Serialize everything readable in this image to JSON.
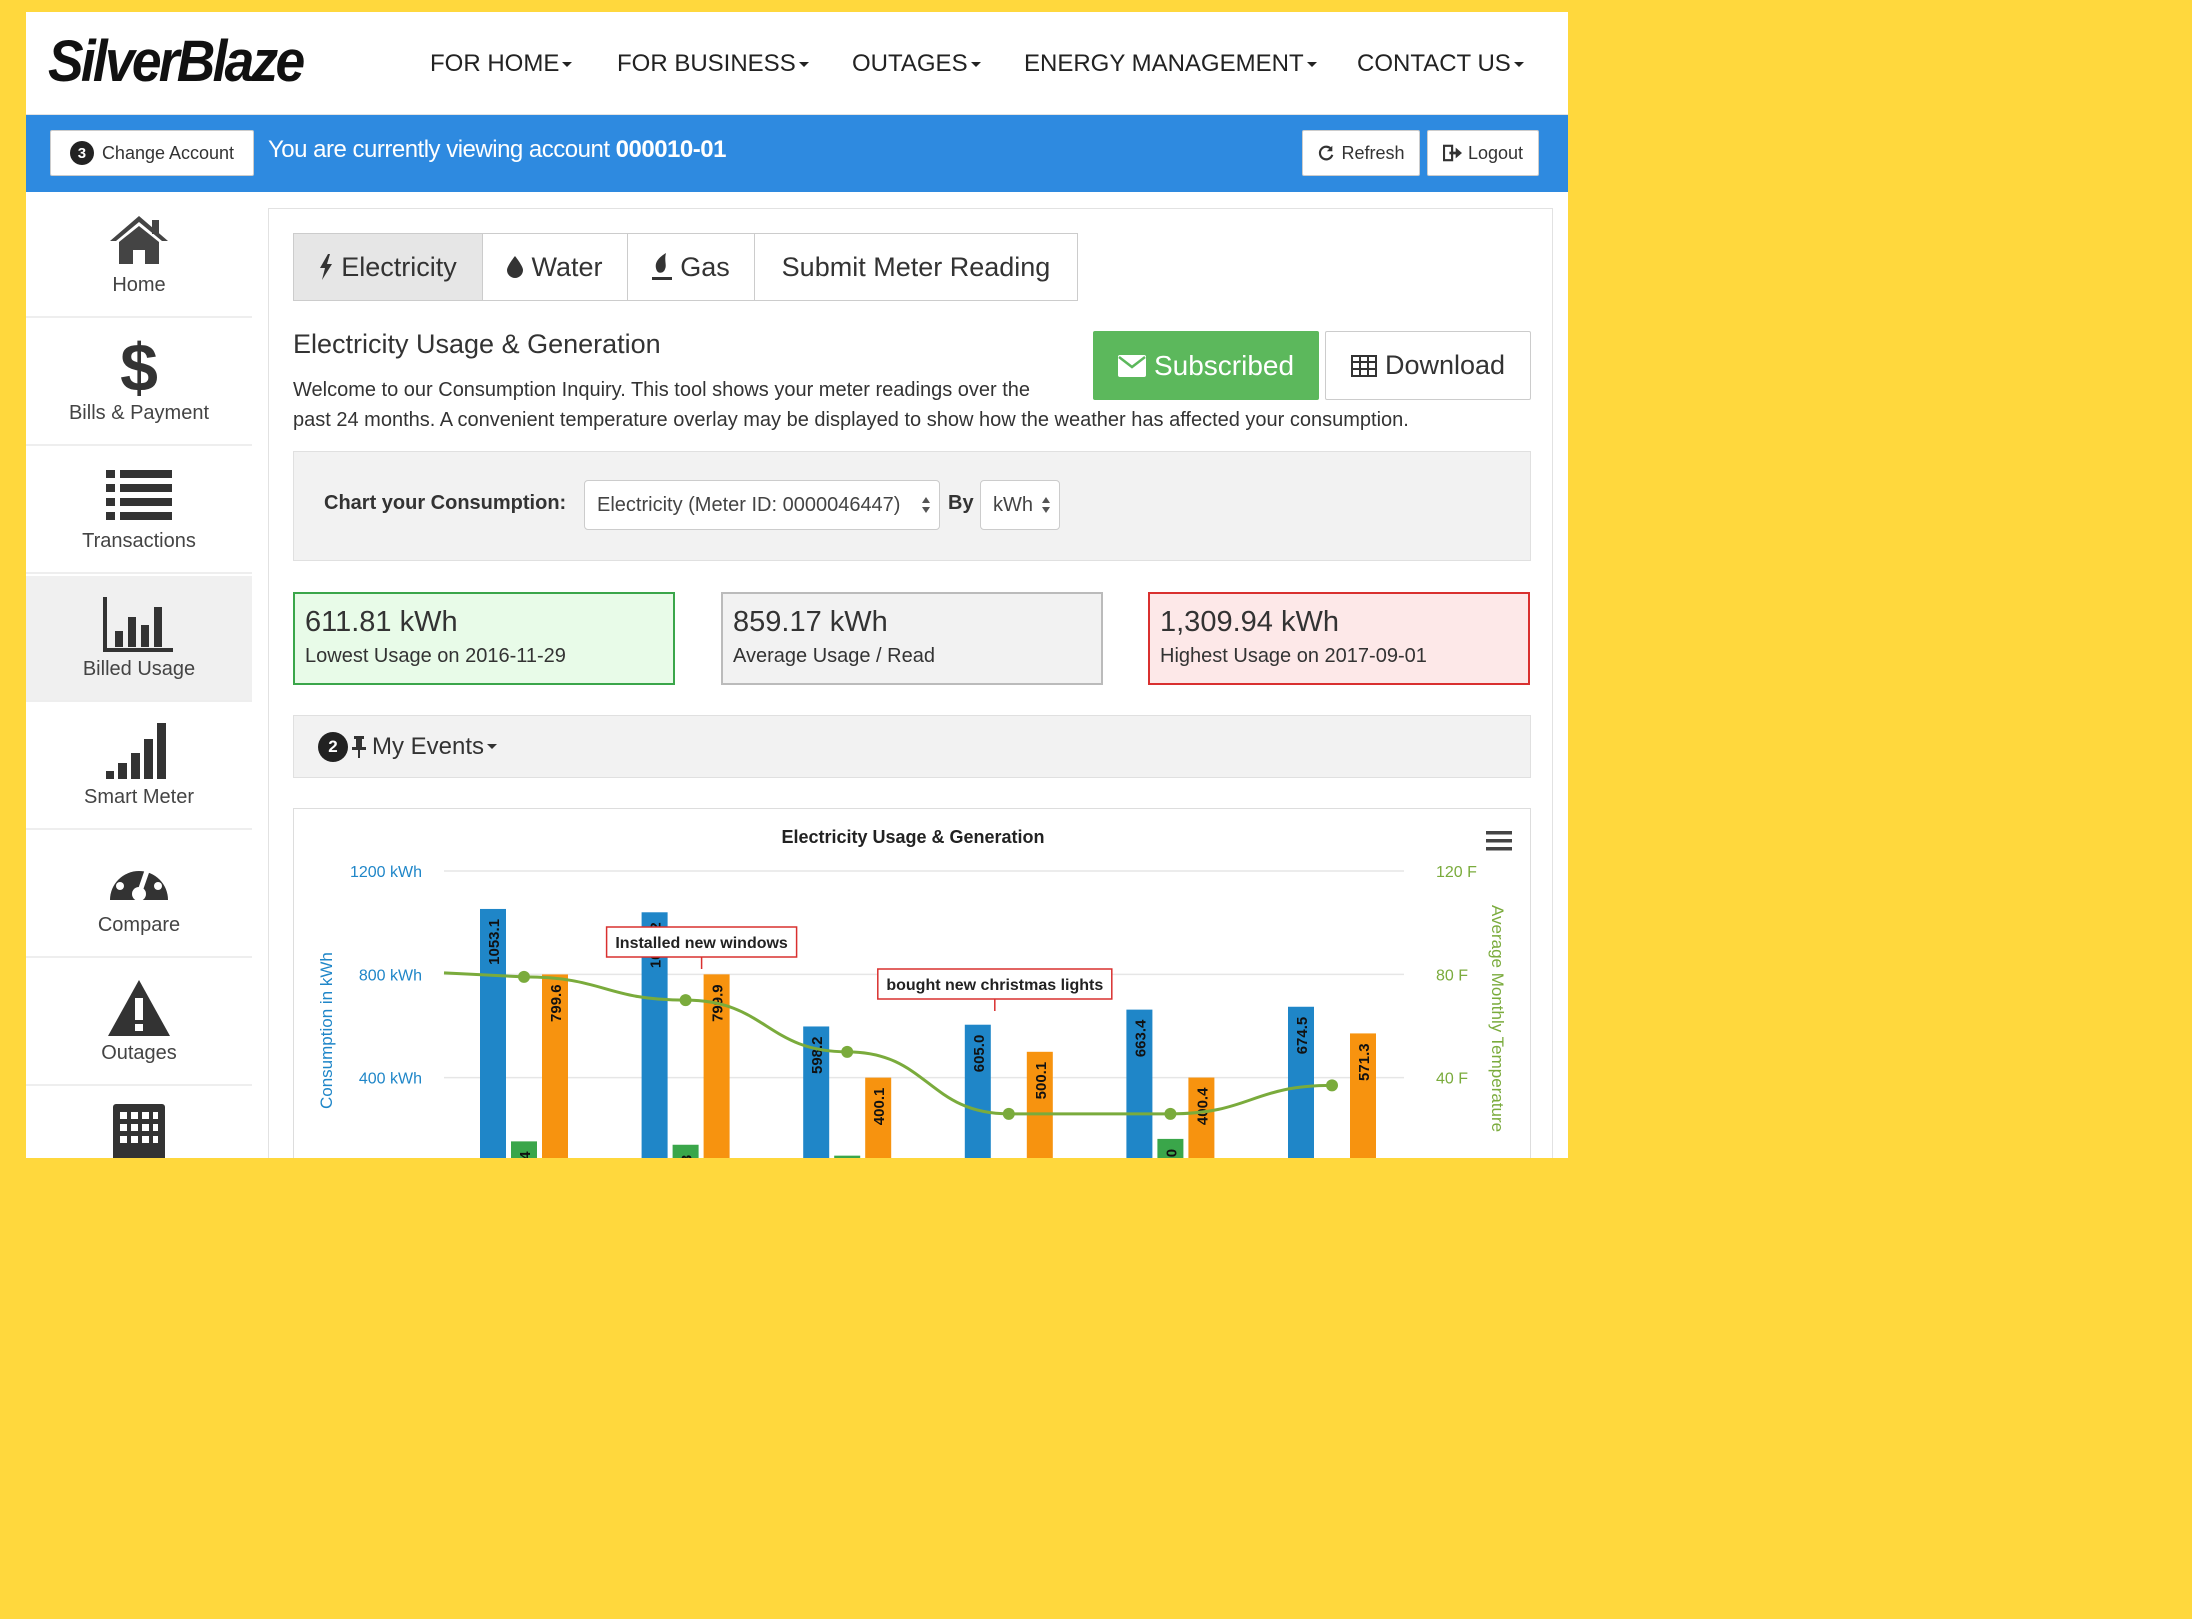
{
  "brand": {
    "logo_text": "SilverBlaze"
  },
  "nav": [
    {
      "label": "FOR HOME"
    },
    {
      "label": "FOR BUSINESS"
    },
    {
      "label": "OUTAGES"
    },
    {
      "label": "ENERGY MANAGEMENT"
    },
    {
      "label": "CONTACT US"
    }
  ],
  "account_bar": {
    "change_account_badge": "3",
    "change_account_label": "Change Account",
    "viewing_prefix": "You are currently viewing account ",
    "account_number": "000010-01",
    "refresh_label": "Refresh",
    "logout_label": "Logout"
  },
  "sidebar": {
    "items": [
      {
        "label": "Home",
        "icon": "home-icon"
      },
      {
        "label": "Bills & Payment",
        "icon": "dollar-icon"
      },
      {
        "label": "Transactions",
        "icon": "list-icon"
      },
      {
        "label": "Billed Usage",
        "icon": "bar-chart-icon",
        "active": true
      },
      {
        "label": "Smart Meter",
        "icon": "signal-icon"
      },
      {
        "label": "Compare",
        "icon": "dashboard-icon"
      },
      {
        "label": "Outages",
        "icon": "warning-icon"
      },
      {
        "label": "",
        "icon": "calculator-icon"
      }
    ]
  },
  "tabs": [
    {
      "label": "Electricity",
      "icon": "bolt-icon",
      "active": true
    },
    {
      "label": "Water",
      "icon": "drop-icon"
    },
    {
      "label": "Gas",
      "icon": "fire-icon"
    },
    {
      "label": "Submit Meter Reading"
    }
  ],
  "usage": {
    "title": "Electricity Usage & Generation",
    "description": "Welcome to our Consumption Inquiry. This tool shows your meter readings over the past 24 months. A convenient temperature overlay may be displayed to show how the weather has affected your consumption.",
    "subscribed_label": "Subscribed",
    "download_label": "Download"
  },
  "chart_form": {
    "label": "Chart your Consumption:",
    "meter_select": "Electricity (Meter ID: 0000046447)",
    "by_label": "By",
    "unit_select": "kWh"
  },
  "stats": [
    {
      "value": "611.81 kWh",
      "caption": "Lowest Usage on 2016-11-29",
      "bg": "#e8fbe8",
      "border": "#3aa64a"
    },
    {
      "value": "859.17 kWh",
      "caption": "Average Usage / Read",
      "bg": "#f2f2f2",
      "border": "#bbbbbb"
    },
    {
      "value": "1,309.94 kWh",
      "caption": "Highest Usage on 2017-09-01",
      "bg": "#fde8e8",
      "border": "#d9302f"
    }
  ],
  "events": {
    "badge": "2",
    "label": "My Events"
  },
  "chart_data": {
    "type": "bar",
    "title": "Electricity Usage & Generation",
    "ylabel": "Consumption in kWh",
    "y2label": "Average Monthly Temperature",
    "ylim": [
      0,
      1200
    ],
    "y2lim": [
      0,
      120
    ],
    "y_ticks": [
      "1200 kWh",
      "800 kWh",
      "400 kWh"
    ],
    "y2_ticks": [
      "120 F",
      "80 F",
      "40 F"
    ],
    "colors": {
      "blue": "#1f86c8",
      "green": "#3aa64a",
      "orange": "#f7930f",
      "temp": "#7aab3c"
    },
    "groups": [
      {
        "blue": 1053.1,
        "green": 153.4,
        "orange": 799.6
      },
      {
        "blue": 1040.2,
        "green": 140.3,
        "orange": 799.9
      },
      {
        "blue": 598.2,
        "green": 98.1,
        "orange": 400.1
      },
      {
        "blue": 605.0,
        "green": 20,
        "orange": 500.1
      },
      {
        "blue": 663.4,
        "green": 163.0,
        "orange": 400.4
      },
      {
        "blue": 674.5,
        "green": 20,
        "orange": 571.3
      }
    ],
    "temperature": [
      79,
      70,
      50,
      26,
      26,
      37
    ],
    "annotations": [
      {
        "text": "Installed new windows",
        "group": 1
      },
      {
        "text": "bought new christmas lights",
        "group": 3
      }
    ]
  }
}
